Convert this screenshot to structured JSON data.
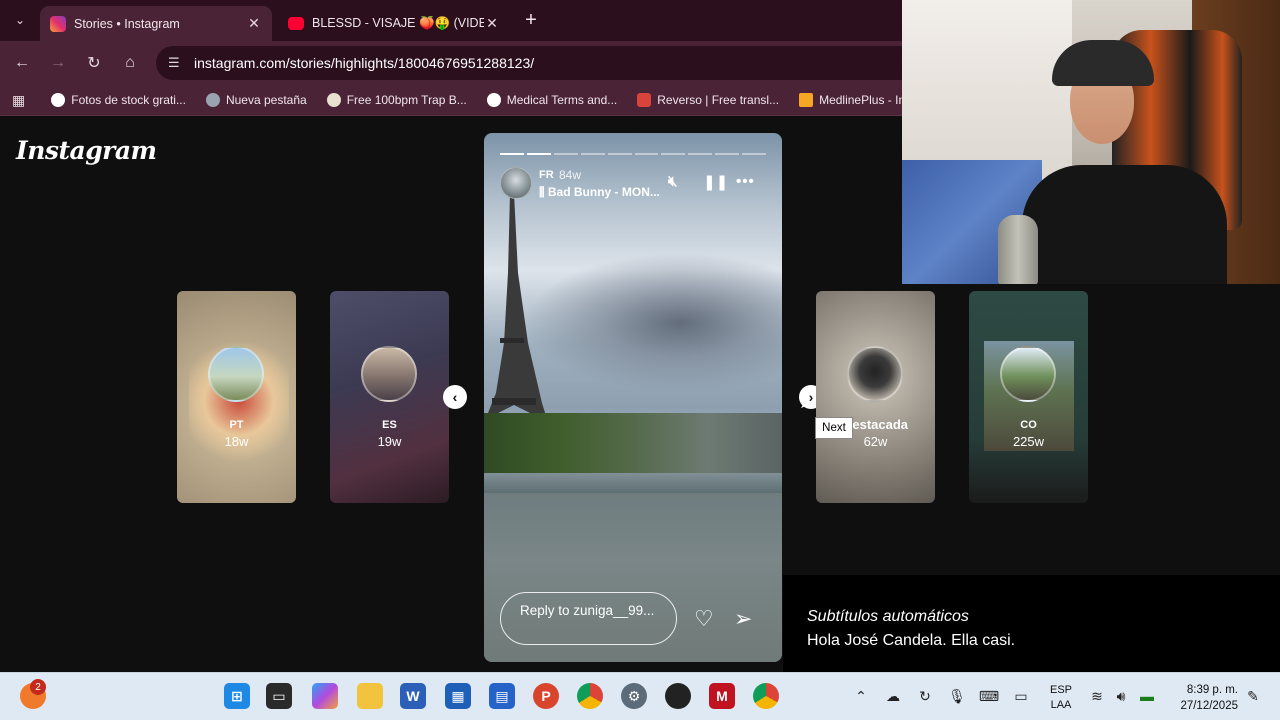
{
  "browser": {
    "tabs": [
      {
        "title": "Stories • Instagram",
        "active": true
      },
      {
        "title": "BLESSD - VISAJE 🍑🤑 (VIDEO",
        "active": false
      }
    ],
    "url": "instagram.com/stories/highlights/18004676951288123/",
    "bookmarks": [
      "Fotos de stock grati...",
      "Nueva pestaña",
      "Free 100bpm Trap B...",
      "Medical Terms and...",
      "Reverso | Free transl...",
      "MedlinePlus - Inf"
    ]
  },
  "instagram": {
    "logo": "Instagram",
    "highlights": [
      {
        "label": "PT",
        "age": "18w"
      },
      {
        "label": "ES",
        "age": "19w"
      },
      {
        "label": "Destacada",
        "age": "62w"
      },
      {
        "label": "CO",
        "age": "225w"
      }
    ],
    "story": {
      "user": "FR",
      "time": "84w",
      "song": "Bad Bunny - MON...",
      "reply_placeholder": "Reply to zuniga__99...",
      "segments_total": 10,
      "segments_done": 2
    },
    "tooltip": "Next"
  },
  "subtitles": {
    "title": "Subtítulos automáticos",
    "text": "Hola José Candela. Ella casi."
  },
  "taskbar": {
    "notification_count": "2",
    "language": {
      "line1": "ESP",
      "line2": "LAA"
    },
    "time": "8:39 p. m.",
    "date": "27/12/2025"
  }
}
